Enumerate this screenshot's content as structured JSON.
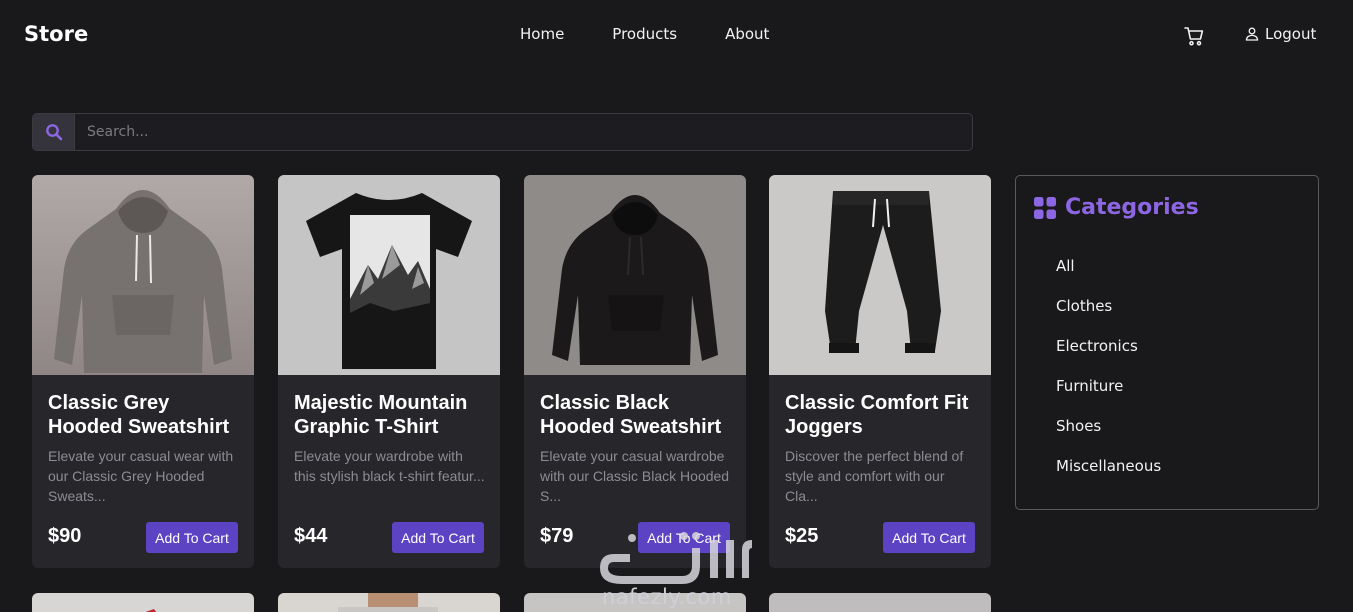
{
  "header": {
    "brand": "Store",
    "nav": [
      "Home",
      "Products",
      "About"
    ],
    "logout_label": "Logout",
    "cart_icon": "cart-icon",
    "user_icon": "user-icon"
  },
  "search": {
    "placeholder": "Search..."
  },
  "products": [
    {
      "title": "Classic Grey Hooded Sweatshirt",
      "desc": "Elevate your casual wear with our Classic Grey Hooded Sweats...",
      "price": "$90",
      "button": "Add To Cart"
    },
    {
      "title": "Majestic Mountain Graphic T-Shirt",
      "desc": "Elevate your wardrobe with this stylish black t-shirt featur...",
      "price": "$44",
      "button": "Add To Cart"
    },
    {
      "title": "Classic Black Hooded Sweatshirt",
      "desc": "Elevate your casual wardrobe with our Classic Black Hooded S...",
      "price": "$79",
      "button": "Add To Cart"
    },
    {
      "title": "Classic Comfort Fit Joggers",
      "desc": "Discover the perfect blend of style and comfort with our Cla...",
      "price": "$25",
      "button": "Add To Cart"
    }
  ],
  "categories": {
    "title": "Categories",
    "items": [
      "All",
      "Clothes",
      "Electronics",
      "Furniture",
      "Shoes",
      "Miscellaneous"
    ]
  },
  "watermark": {
    "text": "nafezly.com"
  },
  "colors": {
    "accent": "#5b43c4",
    "category_title": "#8d67e3",
    "background": "#19181b",
    "card": "#27262b"
  }
}
